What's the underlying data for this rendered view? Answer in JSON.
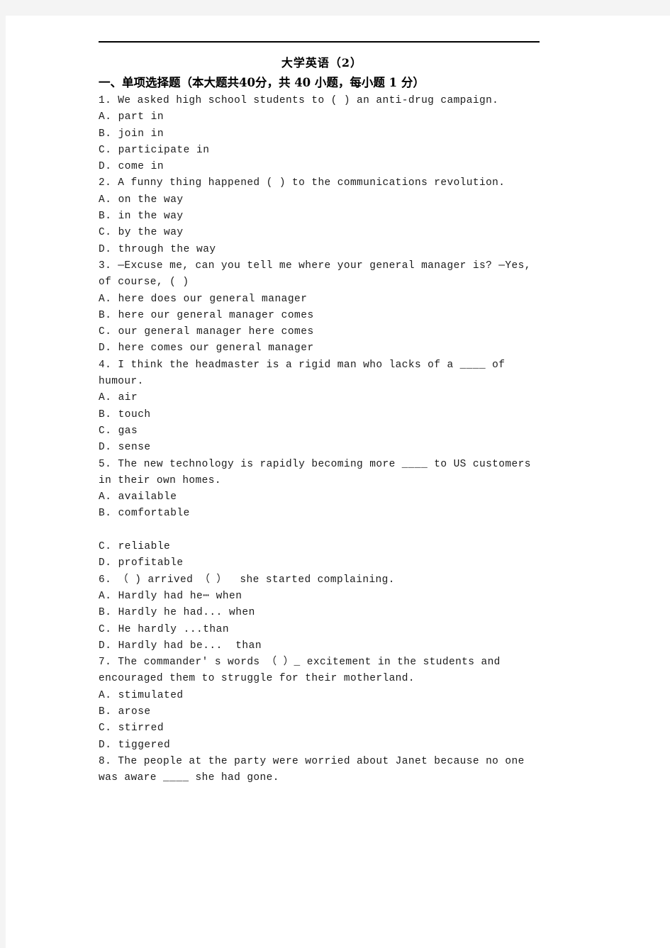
{
  "document": {
    "title": "大学英语（2）",
    "section_heading": "一、单项选择题（本大题共40分，共 40 小题，每小题 1 分）",
    "lines": [
      {
        "kind": "question",
        "text": "1. We asked high school students to ( ) an anti-drug campaign."
      },
      {
        "kind": "option",
        "text": "A. part in"
      },
      {
        "kind": "option",
        "text": "B. join in"
      },
      {
        "kind": "option",
        "text": "C. participate in"
      },
      {
        "kind": "option",
        "text": "D. come in"
      },
      {
        "kind": "question",
        "text": "2. A funny thing happened ( ) to the communications revolution."
      },
      {
        "kind": "option",
        "text": "A. on the way"
      },
      {
        "kind": "option",
        "text": "B. in the way"
      },
      {
        "kind": "option",
        "text": "C. by the way"
      },
      {
        "kind": "option",
        "text": "D. through the way"
      },
      {
        "kind": "question",
        "text": "3. —Excuse me, can you tell me where your general manager is? —Yes, of course, ( )"
      },
      {
        "kind": "option",
        "text": "A. here does our general manager"
      },
      {
        "kind": "option",
        "text": "B. here our general manager comes"
      },
      {
        "kind": "option",
        "text": "C. our general manager here comes"
      },
      {
        "kind": "option",
        "text": "D. here comes our general manager"
      },
      {
        "kind": "question",
        "text": "4. I think the headmaster is a rigid man who lacks of a ____ of humour."
      },
      {
        "kind": "option",
        "text": "A. air"
      },
      {
        "kind": "option",
        "text": "B. touch"
      },
      {
        "kind": "option",
        "text": "C. gas"
      },
      {
        "kind": "option",
        "text": "D. sense"
      },
      {
        "kind": "question",
        "text": "5. The new technology is rapidly becoming more ____ to US customers in their own homes."
      },
      {
        "kind": "option",
        "text": "A. available"
      },
      {
        "kind": "option",
        "text": "B. comfortable"
      },
      {
        "kind": "spacer",
        "text": ""
      },
      {
        "kind": "option",
        "text": "C. reliable"
      },
      {
        "kind": "option",
        "text": "D. profitable"
      },
      {
        "kind": "question",
        "text": "6. （ ) arrived （ ）  she started complaining."
      },
      {
        "kind": "option",
        "text": "A. Hardly had he⋯ when"
      },
      {
        "kind": "option",
        "text": "B. Hardly he had... when"
      },
      {
        "kind": "option",
        "text": "C. He hardly ...than"
      },
      {
        "kind": "option",
        "text": "D. Hardly had be...  than"
      },
      {
        "kind": "question",
        "text": "7. The commander' s words （ ）_ excitement in the students and encouraged them to struggle for their motherland."
      },
      {
        "kind": "option",
        "text": "A. stimulated"
      },
      {
        "kind": "option",
        "text": "B. arose"
      },
      {
        "kind": "option",
        "text": "C. stirred"
      },
      {
        "kind": "option",
        "text": "D. tiggered"
      },
      {
        "kind": "question",
        "text": "8. The people at the party were worried about Janet because no one was aware ____ she had gone."
      }
    ]
  }
}
